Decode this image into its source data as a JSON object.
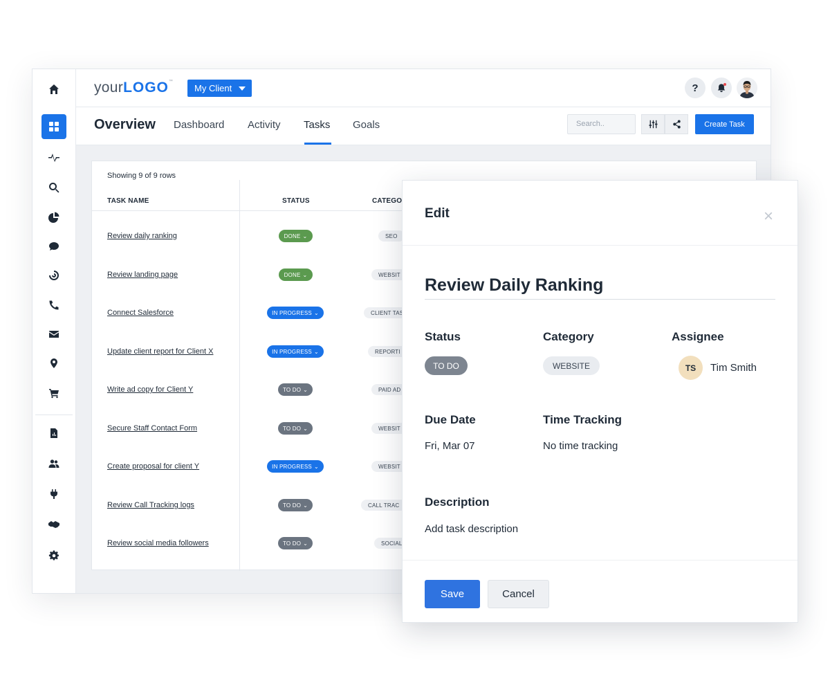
{
  "app": {
    "logo_prefix": "your",
    "logo_strong": "LOGO",
    "logo_tm": "™",
    "client_selector": "My Client",
    "help_label": "?"
  },
  "nav": {
    "title": "Overview",
    "tabs": [
      "Dashboard",
      "Activity",
      "Tasks",
      "Goals"
    ],
    "active_tab": "Tasks",
    "search_placeholder": "Search..",
    "create_task_label": "Create Task"
  },
  "sidebar": {
    "icons": [
      "home-icon",
      "dashboard-grid-icon",
      "activity-pulse-icon",
      "search-icon",
      "pie-chart-icon",
      "chat-icon",
      "target-icon",
      "phone-icon",
      "mail-icon",
      "location-pin-icon",
      "cart-icon",
      "report-icon",
      "users-icon",
      "plug-icon",
      "handshake-icon",
      "gear-icon"
    ],
    "active": "dashboard-grid-icon"
  },
  "table": {
    "showing": "Showing 9 of 9 rows",
    "headers": {
      "task_name": "TASK NAME",
      "status": "STATUS",
      "category": "CATEGO"
    },
    "rows": [
      {
        "name": "Review daily ranking",
        "status": "DONE",
        "category": "SEO"
      },
      {
        "name": "Review landing page",
        "status": "DONE",
        "category": "WEBSIT"
      },
      {
        "name": "Connect Salesforce",
        "status": "IN PROGRESS",
        "category": "CLIENT TAS"
      },
      {
        "name": "Update client report for Client X",
        "status": "IN PROGRESS",
        "category": "REPORTI"
      },
      {
        "name": "Write ad copy for Client Y",
        "status": "TO DO",
        "category": "PAID AD"
      },
      {
        "name": "Secure Staff Contact Form",
        "status": "TO DO",
        "category": "WEBSIT"
      },
      {
        "name": "Create proposal for client Y",
        "status": "IN PROGRESS",
        "category": "WEBSIT"
      },
      {
        "name": "Review Call Tracking logs",
        "status": "TO DO",
        "category": "CALL TRAC"
      },
      {
        "name": "Review social media followers",
        "status": "TO DO",
        "category": "SOCIAL"
      }
    ]
  },
  "modal": {
    "title": "Edit",
    "close": "×",
    "task_title": "Review Daily Ranking",
    "status_label": "Status",
    "status_value": "TO DO",
    "category_label": "Category",
    "category_value": "WEBSITE",
    "assignee_label": "Assignee",
    "assignee_initials": "TS",
    "assignee_name": "Tim Smith",
    "due_label": "Due Date",
    "due_value": "Fri, Mar 07",
    "time_label": "Time Tracking",
    "time_value": "No time tracking",
    "description_label": "Description",
    "description_value": "Add task description",
    "save_label": "Save",
    "cancel_label": "Cancel"
  },
  "colors": {
    "accent": "#1a73e8",
    "done": "#5b9a4f",
    "todo": "#6b7480"
  }
}
